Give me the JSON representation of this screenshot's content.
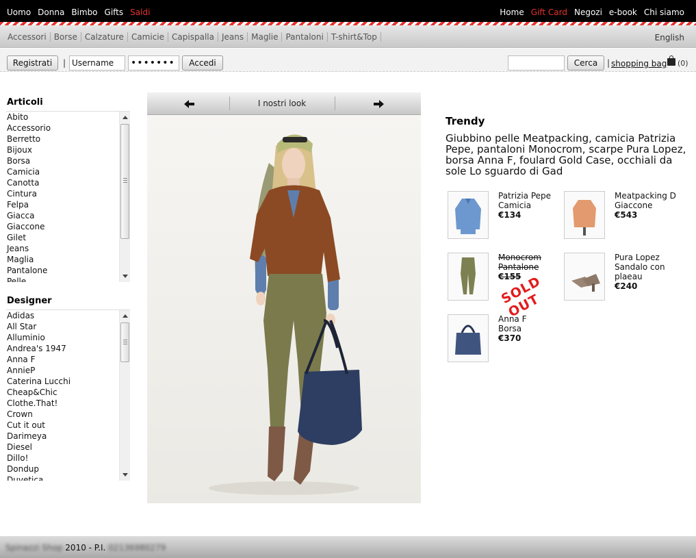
{
  "topnav": {
    "left": [
      {
        "label": "Uomo",
        "highlight": false
      },
      {
        "label": "Donna",
        "highlight": false
      },
      {
        "label": "Bimbo",
        "highlight": false
      },
      {
        "label": "Gifts",
        "highlight": false
      },
      {
        "label": "Saldi",
        "highlight": true
      }
    ],
    "right": [
      {
        "label": "Home",
        "highlight": false
      },
      {
        "label": "Gift Card",
        "highlight": true
      },
      {
        "label": "Negozi",
        "highlight": false
      },
      {
        "label": "e-book",
        "highlight": false
      },
      {
        "label": "Chi siamo",
        "highlight": false
      }
    ],
    "accent_color": "#e3342f"
  },
  "categories": [
    "Accessori",
    "Borse",
    "Calzature",
    "Camicie",
    "Capispalla",
    "Jeans",
    "Maglie",
    "Pantaloni",
    "T-shirt&Top"
  ],
  "language": "English",
  "login": {
    "register_label": "Registrati",
    "separator": "|",
    "username_value": "Username",
    "password_value": "••••••••",
    "login_label": "Accedi",
    "search_value": "",
    "search_label": "Cerca",
    "bag_separator": "|",
    "bag_label": "shopping bag",
    "bag_count": "(0)"
  },
  "articoli": {
    "title": "Articoli",
    "items": [
      "Abito",
      "Accessorio",
      "Berretto",
      "Bijoux",
      "Borsa",
      "Camicia",
      "Canotta",
      "Cintura",
      "Felpa",
      "Giacca",
      "Giaccone",
      "Gilet",
      "Jeans",
      "Maglia",
      "Pantalone",
      "Pelle"
    ]
  },
  "designer": {
    "title": "Designer",
    "items": [
      "Adidas",
      "All Star",
      "Alluminio",
      "Andrea's 1947",
      "Anna F",
      "AnnieP",
      "Caterina Lucchi",
      "Cheap&Chic",
      "Clothe.That!",
      "Crown",
      "Cut it out",
      "Darimeya",
      "Diesel",
      "Dillo!",
      "Dondup",
      "Duvetica"
    ]
  },
  "look": {
    "title": "I nostri look",
    "prev_icon": "arrow-left-icon",
    "next_icon": "arrow-right-icon"
  },
  "trendy": {
    "title": "Trendy",
    "description": "Giubbino pelle Meatpacking, camicia Patrizia Pepe, pantaloni Monocrom, scarpe Pura Lopez, borsa Anna F, foulard Gold Case, occhiali da sole Lo sguardo di Gad",
    "products": [
      {
        "line1": "Patrizia Pepe",
        "line2": "Camicia",
        "price": "€134",
        "sold_out": false
      },
      {
        "line1": "Meatpacking D",
        "line2": "Giaccone",
        "price": "€543",
        "sold_out": false
      },
      {
        "line1": "Monocrom",
        "line2": "Pantalone",
        "price": "€155",
        "sold_out": true,
        "sold_label": "SOLD OUT"
      },
      {
        "line1": "Pura Lopez",
        "line2": "Sandalo con plaeau",
        "price": "€240",
        "sold_out": false
      },
      {
        "line1": "Anna F",
        "line2": "Borsa",
        "price": "€370",
        "sold_out": false
      }
    ]
  },
  "footer": {
    "shop_name": "Spinazzi Shop",
    "year": "2010 - P.I.",
    "vat": "02136980279"
  }
}
